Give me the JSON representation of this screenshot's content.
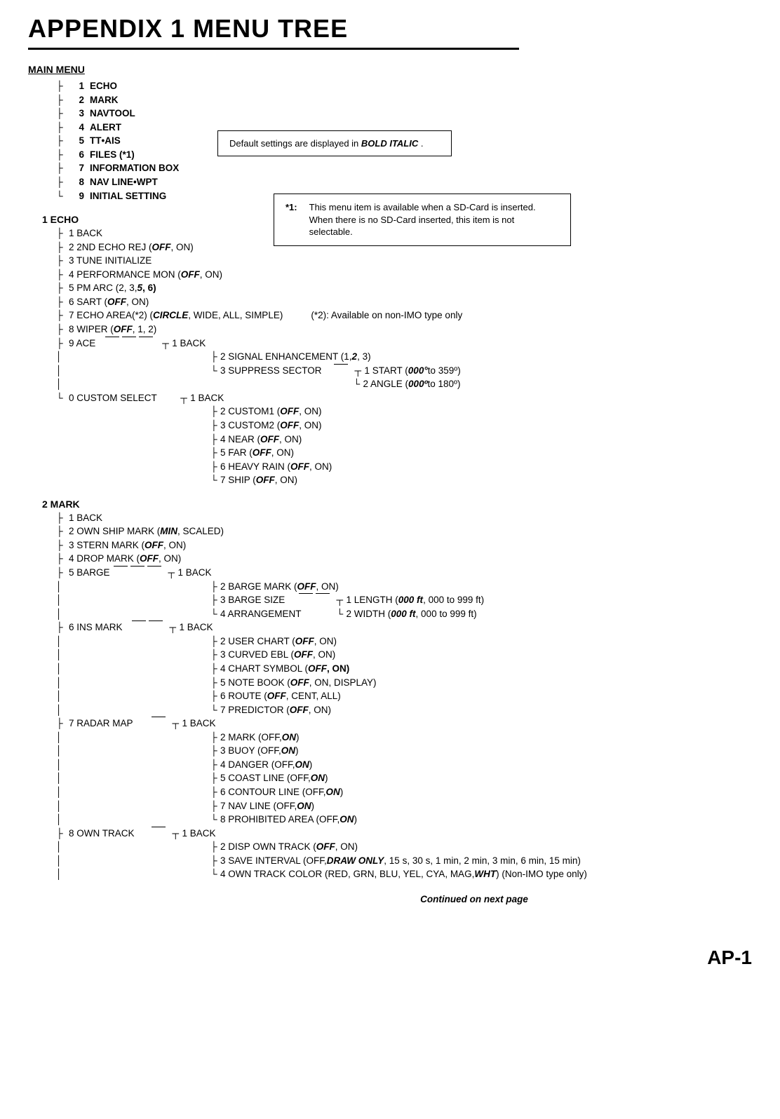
{
  "title": "APPENDIX 1 MENU TREE",
  "note1": {
    "prefix": "Default settings are displayed in ",
    "bold": "BOLD ITALIC",
    "suffix": " ."
  },
  "note2": {
    "tag": "*1:",
    "line1": "This menu item is available when a SD-Card is inserted.",
    "line2": "When there is no SD-Card inserted, this item is not selectable."
  },
  "mainHeading": "MAIN MENU",
  "mainItems": [
    {
      "n": "1",
      "l": "ECHO"
    },
    {
      "n": "2",
      "l": "MARK"
    },
    {
      "n": "3",
      "l": "NAVTOOL"
    },
    {
      "n": "4",
      "l": "ALERT"
    },
    {
      "n": "5",
      "l": "TT•AIS"
    },
    {
      "n": "6",
      "l": "FILES (*1)"
    },
    {
      "n": "7",
      "l": "INFORMATION BOX"
    },
    {
      "n": "8",
      "l": "NAV LINE•WPT"
    },
    {
      "n": "9",
      "l": "INITIAL SETTING"
    }
  ],
  "s1": {
    "head": "1 ECHO",
    "i1": "1 BACK",
    "i2a": "2 2ND ECHO REJ (",
    "i2b": "OFF",
    "i2c": " , ON)",
    "i3": "3 TUNE INITIALIZE",
    "i4a": "4 PERFORMANCE MON (",
    "i4b": "OFF",
    "i4c": " , ON)",
    "i5a": "5 PM ARC (2, 3, ",
    "i5b": "5",
    "i5c": " , 6)",
    "i6a": "6 SART (",
    "i6b": "OFF",
    "i6c": " , ON)",
    "i7a": "7 ECHO AREA(*2) (",
    "i7b": "CIRCLE",
    "i7c": " , WIDE, ALL, SIMPLE)",
    "i7n": "(*2): Available on non-IMO type only",
    "i8a": "8 WIPER (",
    "i8b": "OFF",
    "i8c": " , 1, 2)",
    "i9": "9 ACE",
    "ace1": "1 BACK",
    "ace2a": "2 SIGNAL ENHANCEMENT (1, ",
    "ace2b": "2",
    "ace2c": " , 3)",
    "ace3": "3 SUPPRESS SECTOR",
    "ss1a": "1 START (",
    "ss1b": "000°",
    "ss1c": " to 359º)",
    "ss2a": "2 ANGLE (",
    "ss2b": "000º",
    "ss2c": " to 180º)",
    "i10": "0 CUSTOM SELECT",
    "cs1": "1 BACK",
    "cs2a": "2 CUSTOM1 (",
    "cs2b": "OFF",
    "cs2c": " , ON)",
    "cs3a": "3 CUSTOM2 (",
    "cs3b": "OFF",
    "cs3c": " , ON)",
    "cs4a": "4 NEAR (",
    "cs4b": "OFF",
    "cs4c": " , ON)",
    "cs5a": "5 FAR (",
    "cs5b": "OFF",
    "cs5c": " , ON)",
    "cs6a": "6 HEAVY RAIN (",
    "cs6b": "OFF",
    "cs6c": " , ON)",
    "cs7a": "7 SHIP (",
    "cs7b": "OFF",
    "cs7c": " , ON)"
  },
  "s2": {
    "head": "2 MARK",
    "i1": "1 BACK",
    "i2a": "2 OWN SHIP MARK (",
    "i2b": "MIN",
    "i2c": " , SCALED)",
    "i3a": "3 STERN MARK (",
    "i3b": "OFF",
    "i3c": " , ON)",
    "i4a": "4 DROP MARK (",
    "i4b": "OFF",
    "i4c": " , ON)",
    "i5": "5 BARGE",
    "bg1": "1 BACK",
    "bg2a": "2 BARGE MARK (",
    "bg2b": "OFF",
    "bg2c": " , ON)",
    "bg3": "3 BARGE SIZE",
    "bs1a": "1 LENGTH (",
    "bs1b": "000 ft",
    "bs1c": " , 000 to 999 ft)",
    "bs2a": "2 WIDTH (",
    "bs2b": "000 ft",
    "bs2c": " , 000 to 999 ft)",
    "bg4": "4 ARRANGEMENT",
    "i6": "6 INS MARK",
    "in1": "1 BACK",
    "in2a": "2 USER CHART (",
    "in2b": "OFF",
    "in2c": " , ON)",
    "in3a": "3 CURVED EBL (",
    "in3b": "OFF",
    "in3c": " , ON)",
    "in4a": "4 CHART SYMBOL (",
    "in4b": "OFF",
    "in4c": " , ON)",
    "in5a": "5 NOTE BOOK (",
    "in5b": "OFF",
    "in5c": " , ON, DISPLAY)",
    "in6a": "6 ROUTE (",
    "in6b": "OFF",
    "in6c": " , CENT, ALL)",
    "in7a": "7 PREDICTOR (",
    "in7b": "OFF",
    "in7c": " , ON)",
    "i7": "7 RADAR MAP",
    "rm1": "1 BACK",
    "rm2a": "2 MARK (OFF, ",
    "rm2b": "ON",
    "rm2c": " )",
    "rm3a": "3 BUOY (OFF, ",
    "rm3b": "ON",
    "rm3c": " )",
    "rm4a": "4 DANGER (OFF, ",
    "rm4b": "ON",
    "rm4c": " )",
    "rm5a": "5 COAST LINE (OFF, ",
    "rm5b": "ON",
    "rm5c": " )",
    "rm6a": "6 CONTOUR LINE (OFF, ",
    "rm6b": "ON",
    "rm6c": " )",
    "rm7a": "7 NAV LINE (OFF, ",
    "rm7b": "ON",
    "rm7c": " )",
    "rm8a": "8 PROHIBITED AREA (OFF, ",
    "rm8b": "ON",
    "rm8c": " )",
    "i8": "8 OWN TRACK",
    "ot1": "1 BACK",
    "ot2a": "2 DISP OWN TRACK (",
    "ot2b": "OFF",
    "ot2c": " , ON)",
    "ot3a": "3 SAVE INTERVAL (OFF, ",
    "ot3b": "DRAW ONLY",
    "ot3c": " , 15 s, 30 s, 1 min, 2 min, 3 min, 6 min, 15 min)",
    "ot4a": "4 OWN TRACK COLOR (RED, GRN, BLU, YEL, CYA, MAG, ",
    "ot4b": "WHT",
    "ot4c": " ) (Non-IMO type only)"
  },
  "continued": "Continued on next page",
  "pageNum": "AP-1"
}
